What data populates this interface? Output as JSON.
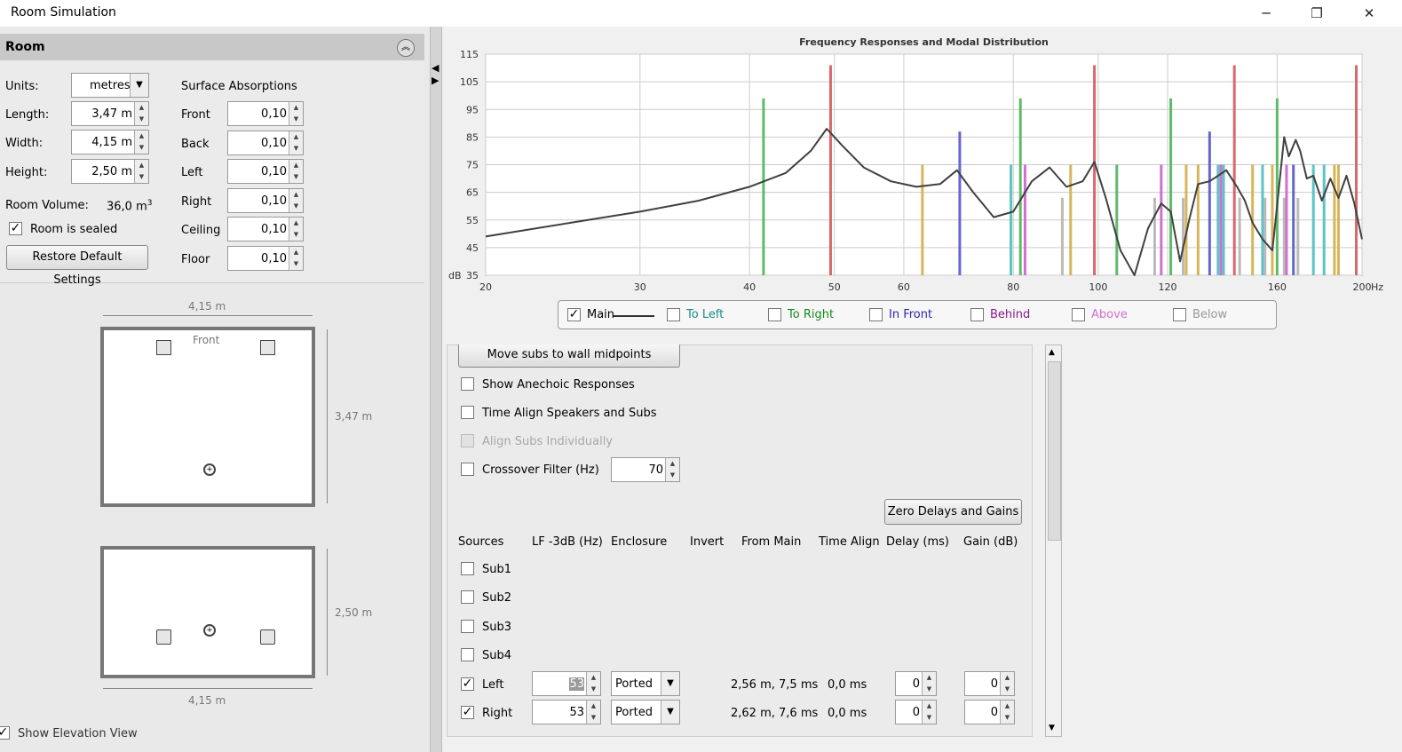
{
  "window": {
    "title": "Room Simulation",
    "minimize": "─",
    "restore": "❐",
    "close": "✕"
  },
  "room": {
    "header": "Room",
    "units_label": "Units:",
    "units_value": "metres",
    "length_label": "Length:",
    "length_value": "3,47 m",
    "width_label": "Width:",
    "width_value": "4,15 m",
    "height_label": "Height:",
    "height_value": "2,50 m",
    "volume_label": "Room Volume:",
    "volume_value": "36,0 m",
    "volume_unit_sup": "3",
    "sealed_label": "Room is sealed",
    "restore_button": "Restore Default Settings",
    "surface_title": "Surface Absorptions",
    "surfaces": [
      {
        "label": "Front",
        "value": "0,10"
      },
      {
        "label": "Back",
        "value": "0,10"
      },
      {
        "label": "Left",
        "value": "0,10"
      },
      {
        "label": "Right",
        "value": "0,10"
      },
      {
        "label": "Ceiling",
        "value": "0,10"
      },
      {
        "label": "Floor",
        "value": "0,10"
      }
    ]
  },
  "plan": {
    "top_width": "4,15 m",
    "front": "Front",
    "length_dim": "3,47 m",
    "height_dim": "2,50 m",
    "bottom_width": "4,15 m",
    "show_elevation": "Show Elevation View"
  },
  "chart_data": {
    "type": "line",
    "title": "Frequency Responses and Modal Distribution",
    "ylabel": "dB",
    "xunit": "Hz",
    "xscale": "log",
    "xlim": [
      20,
      200
    ],
    "ylim": [
      35,
      115
    ],
    "xticks": [
      "20",
      "30",
      "40",
      "50",
      "60",
      "80",
      "100",
      "120",
      "160",
      "200"
    ],
    "xtick_values": [
      20,
      30,
      40,
      50,
      60,
      80,
      100,
      120,
      160,
      200
    ],
    "yticks": [
      35,
      45,
      55,
      65,
      75,
      85,
      95,
      105,
      115
    ],
    "grid": true,
    "series": [
      {
        "name": "Main",
        "color": "#404040",
        "x": [
          20,
          25,
          30,
          35,
          40,
          44,
          47,
          49,
          51,
          54,
          58,
          62,
          66,
          69,
          72,
          76,
          80,
          84,
          88,
          92,
          96,
          99,
          102,
          106,
          110,
          114,
          118,
          121,
          124,
          127,
          130,
          134,
          137,
          140,
          144,
          147,
          150,
          154,
          158,
          160,
          163,
          165,
          168,
          170,
          173,
          176,
          180,
          184,
          188,
          192,
          196,
          200
        ],
        "y": [
          49,
          54,
          58,
          62,
          67,
          72,
          80,
          88,
          82,
          74,
          69,
          67,
          68,
          73,
          65,
          56,
          58,
          69,
          74,
          67,
          69,
          76,
          63,
          44,
          35,
          52,
          61,
          58,
          40,
          55,
          68,
          69,
          71,
          73,
          67,
          62,
          54,
          48,
          44,
          60,
          85,
          78,
          84,
          80,
          70,
          71,
          62,
          70,
          63,
          71,
          61,
          48
        ]
      }
    ],
    "modes": [
      {
        "f": 41.5,
        "db": 99,
        "color": "#5fba6a"
      },
      {
        "f": 49.5,
        "db": 111,
        "color": "#d9686b"
      },
      {
        "f": 63,
        "db": 75,
        "color": "#d8b45a"
      },
      {
        "f": 69.5,
        "db": 87,
        "color": "#6666cc"
      },
      {
        "f": 79.5,
        "db": 75,
        "color": "#5bc4c4"
      },
      {
        "f": 81.5,
        "db": 99,
        "color": "#5fba6a"
      },
      {
        "f": 82.5,
        "db": 75,
        "color": "#d070d0"
      },
      {
        "f": 91,
        "db": 63,
        "color": "#bbbbbb"
      },
      {
        "f": 93,
        "db": 75,
        "color": "#d8b45a"
      },
      {
        "f": 99,
        "db": 111,
        "color": "#d9686b"
      },
      {
        "f": 105,
        "db": 75,
        "color": "#5fba6a"
      },
      {
        "f": 116,
        "db": 63,
        "color": "#bbbbbb"
      },
      {
        "f": 118,
        "db": 75,
        "color": "#d070d0"
      },
      {
        "f": 121,
        "db": 99,
        "color": "#5fba6a"
      },
      {
        "f": 125,
        "db": 63,
        "color": "#bbbbbb"
      },
      {
        "f": 126,
        "db": 75,
        "color": "#d8b45a"
      },
      {
        "f": 130,
        "db": 75,
        "color": "#d8b45a"
      },
      {
        "f": 134,
        "db": 87,
        "color": "#6666cc"
      },
      {
        "f": 137,
        "db": 75,
        "color": "#5bc4c4"
      },
      {
        "f": 138,
        "db": 75,
        "color": "#d070d0"
      },
      {
        "f": 139,
        "db": 75,
        "color": "#5bc4c4"
      },
      {
        "f": 143,
        "db": 111,
        "color": "#d9686b"
      },
      {
        "f": 145,
        "db": 63,
        "color": "#bbbbbb"
      },
      {
        "f": 150,
        "db": 75,
        "color": "#d8b45a"
      },
      {
        "f": 154,
        "db": 75,
        "color": "#5bc4c4"
      },
      {
        "f": 155,
        "db": 63,
        "color": "#bbbbbb"
      },
      {
        "f": 158,
        "db": 75,
        "color": "#d8b45a"
      },
      {
        "f": 160,
        "db": 99,
        "color": "#5fba6a"
      },
      {
        "f": 163,
        "db": 63,
        "color": "#bbbbbb"
      },
      {
        "f": 164,
        "db": 75,
        "color": "#d070d0"
      },
      {
        "f": 167,
        "db": 75,
        "color": "#6666cc"
      },
      {
        "f": 169,
        "db": 63,
        "color": "#bbbbbb"
      },
      {
        "f": 176,
        "db": 75,
        "color": "#5bc4c4"
      },
      {
        "f": 181,
        "db": 75,
        "color": "#5bc4c4"
      },
      {
        "f": 186,
        "db": 75,
        "color": "#d8b45a"
      },
      {
        "f": 188,
        "db": 75,
        "color": "#d8b45a"
      },
      {
        "f": 197,
        "db": 111,
        "color": "#d9686b"
      }
    ]
  },
  "legend": [
    {
      "label": "Main",
      "checked": true,
      "color": "#000000"
    },
    {
      "label": "To Left",
      "checked": false,
      "color": "#1a8a8a"
    },
    {
      "label": "To Right",
      "checked": false,
      "color": "#1a8a1a"
    },
    {
      "label": "In Front",
      "checked": false,
      "color": "#2a2ab0"
    },
    {
      "label": "Behind",
      "checked": false,
      "color": "#8a1a8a"
    },
    {
      "label": "Above",
      "checked": false,
      "color": "#d070d0"
    },
    {
      "label": "Below",
      "checked": false,
      "color": "#999999"
    }
  ],
  "options": {
    "move_subs": "Move subs to wall midpoints",
    "show_anechoic": "Show Anechoic Responses",
    "time_align": "Time Align Speakers and Subs",
    "align_subs": "Align Subs Individually",
    "crossover": "Crossover Filter (Hz)",
    "crossover_value": "70",
    "zero_button": "Zero Delays and Gains"
  },
  "sources": {
    "headers": [
      "Sources",
      "LF -3dB (Hz)",
      "Enclosure",
      "Invert",
      "From Main",
      "Time Align",
      "Delay (ms)",
      "Gain (dB)"
    ],
    "subs": [
      "Sub1",
      "Sub2",
      "Sub3",
      "Sub4"
    ],
    "rows": [
      {
        "name": "Left",
        "lf": "53",
        "enclosure": "Ported",
        "from_main": "2,56 m, 7,5 ms",
        "time_align": "0,0 ms",
        "delay": "0",
        "gain": "0"
      },
      {
        "name": "Right",
        "lf": "53",
        "enclosure": "Ported",
        "from_main": "2,62 m, 7,6 ms",
        "time_align": "0,0 ms",
        "delay": "0",
        "gain": "0"
      }
    ]
  }
}
